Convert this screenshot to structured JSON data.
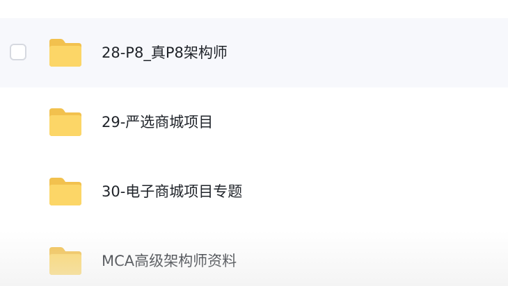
{
  "file_list": {
    "items": [
      {
        "name": "28-P8_真P8架构师",
        "icon": "folder-icon",
        "hovered": true
      },
      {
        "name": "29-严选商城项目",
        "icon": "folder-icon",
        "hovered": false
      },
      {
        "name": "30-电子商城项目专题",
        "icon": "folder-icon",
        "hovered": false
      },
      {
        "name": "MCA高级架构师资料",
        "icon": "folder-icon",
        "hovered": false
      }
    ]
  },
  "colors": {
    "folder_back": "#f2c14e",
    "folder_front": "#fcd667",
    "hover_background": "#f7f8fc",
    "text": "#1f2329"
  }
}
